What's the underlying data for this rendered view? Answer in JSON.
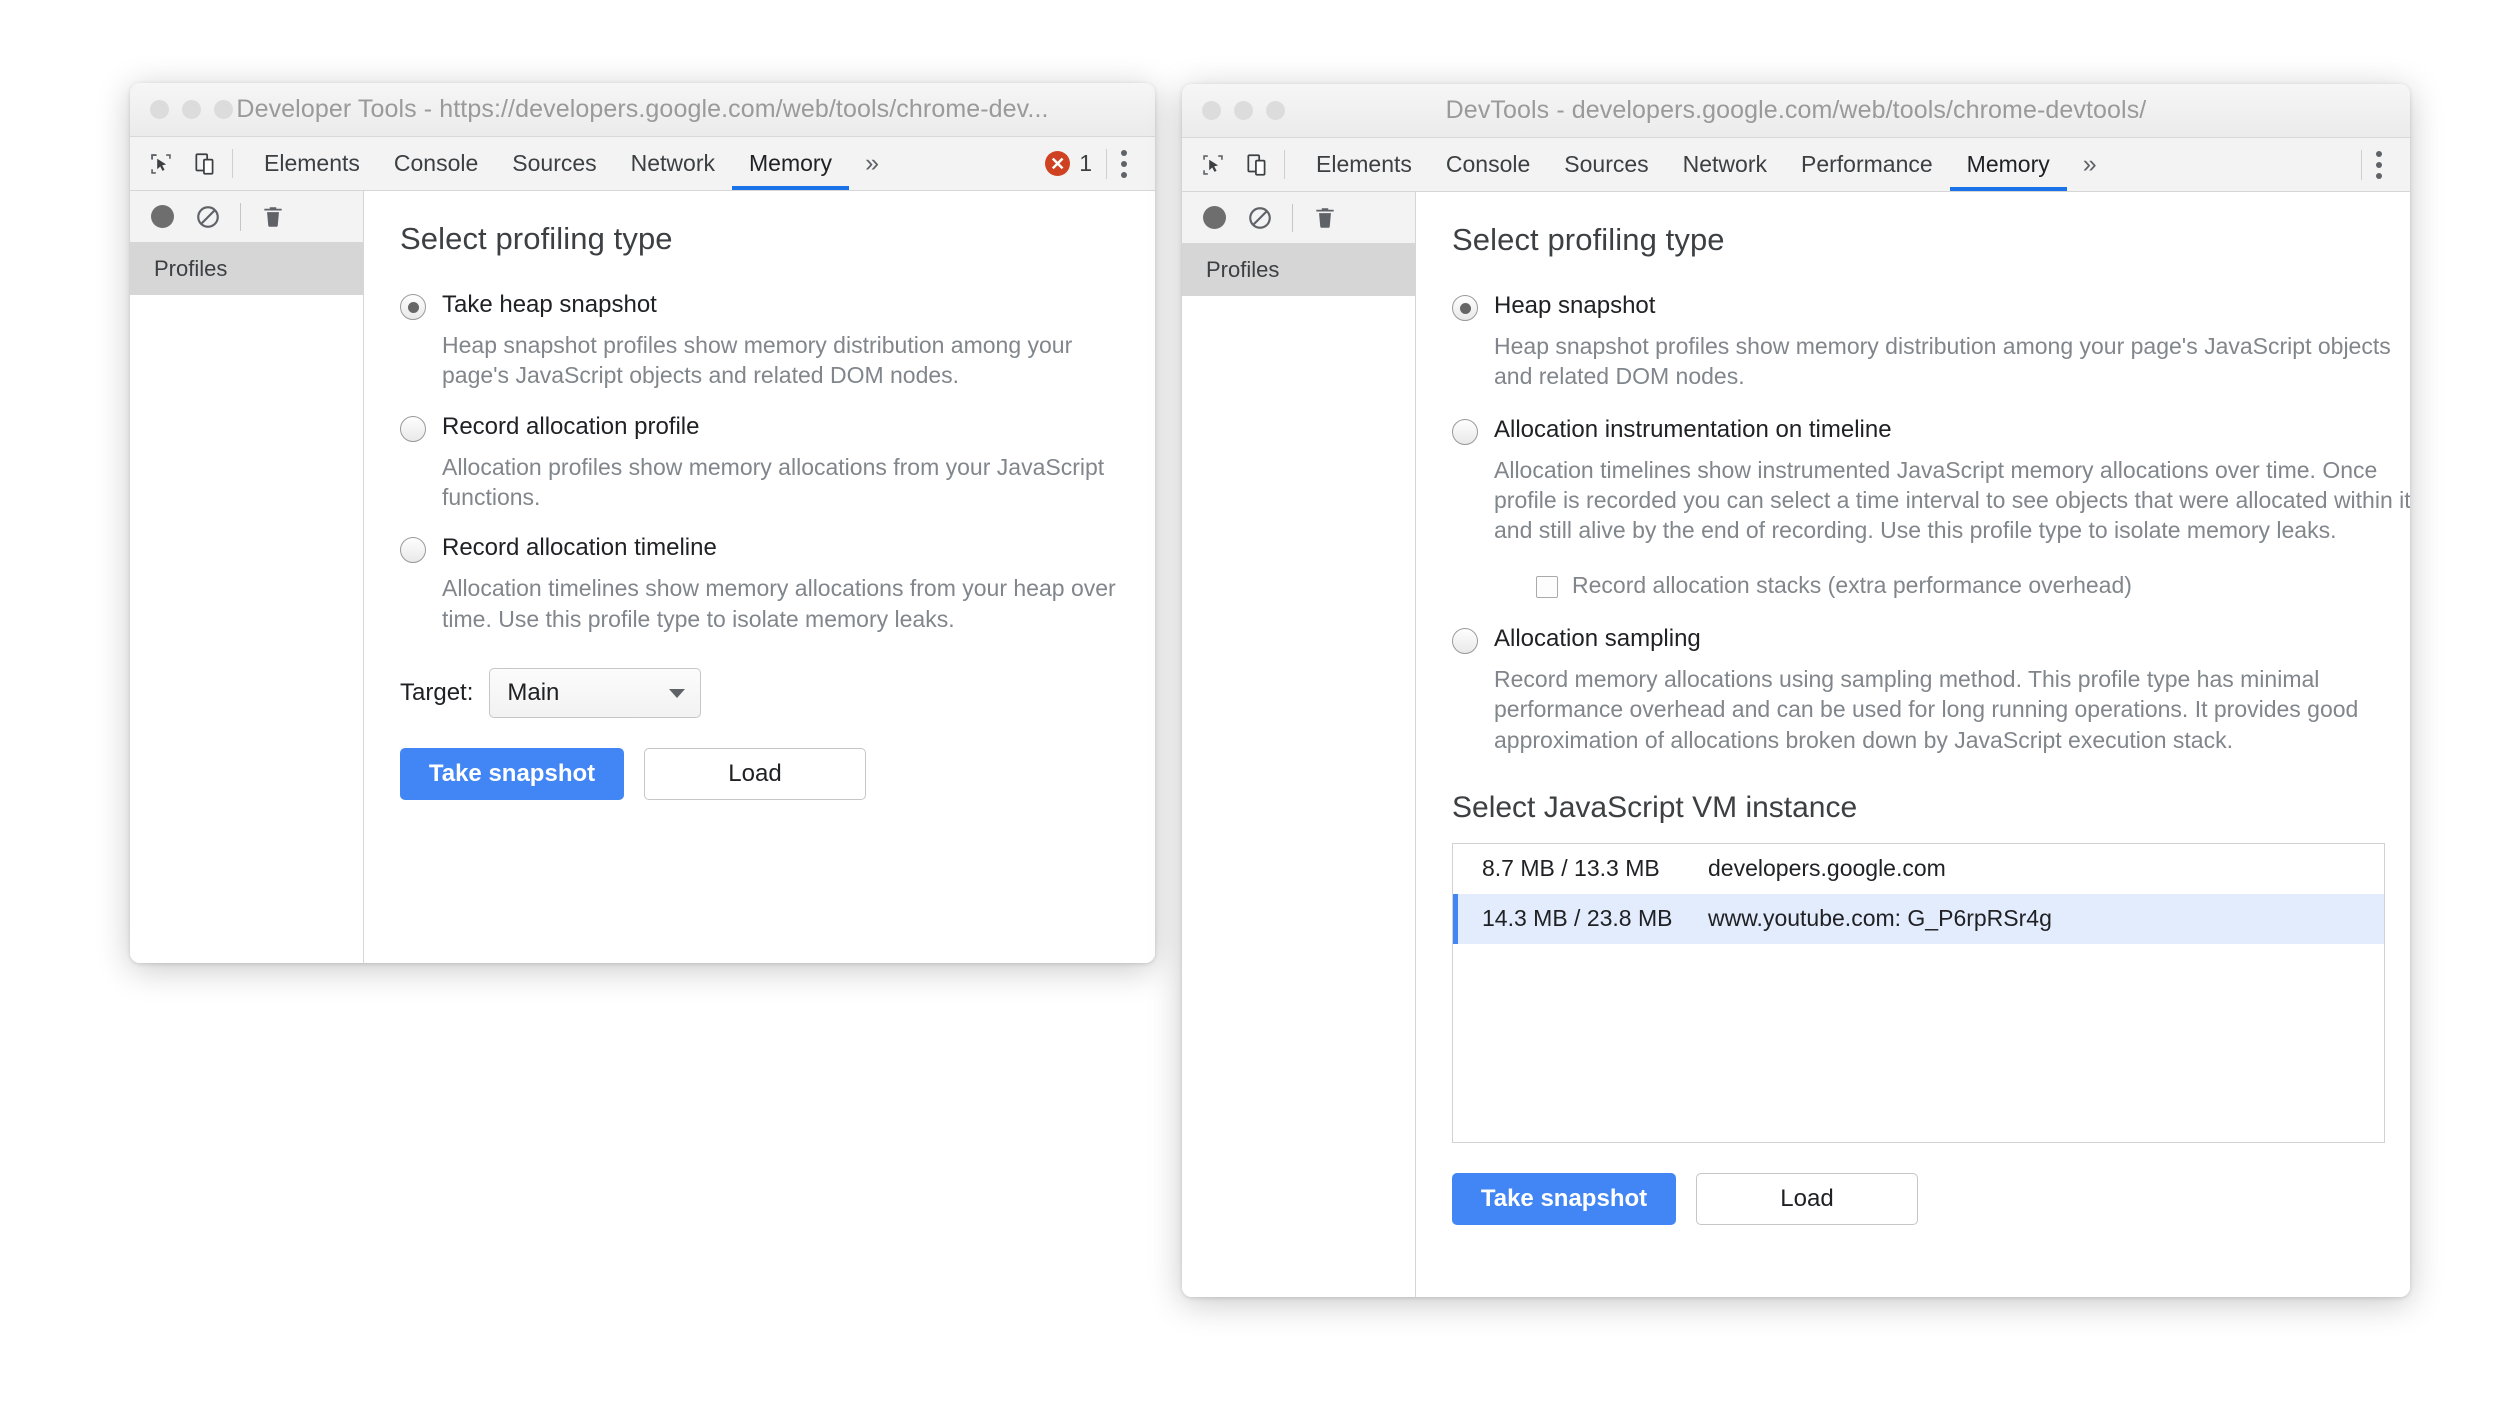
{
  "left_window": {
    "title": "Developer Tools - https://developers.google.com/web/tools/chrome-dev...",
    "toolbar_icons": [
      "inspect-element-icon",
      "device-toolbar-icon"
    ],
    "tabs": [
      {
        "label": "Elements",
        "active": false
      },
      {
        "label": "Console",
        "active": false
      },
      {
        "label": "Sources",
        "active": false
      },
      {
        "label": "Network",
        "active": false
      },
      {
        "label": "Memory",
        "active": true
      }
    ],
    "overflow_label": "»",
    "error_badge": {
      "icon": "✕",
      "count": "1",
      "color": "#cf4221"
    },
    "sidebar": {
      "toolbar_icons": [
        "record-icon",
        "clear-icon",
        "trash-icon"
      ],
      "items": [
        {
          "label": "Profiles",
          "selected": true
        }
      ]
    },
    "panel": {
      "heading": "Select profiling type",
      "options": [
        {
          "label": "Take heap snapshot",
          "checked": true,
          "description": "Heap snapshot profiles show memory distribution among your page's JavaScript objects and related DOM nodes."
        },
        {
          "label": "Record allocation profile",
          "checked": false,
          "description": "Allocation profiles show memory allocations from your JavaScript functions."
        },
        {
          "label": "Record allocation timeline",
          "checked": false,
          "description": "Allocation timelines show memory allocations from your heap over time. Use this profile type to isolate memory leaks."
        }
      ],
      "target": {
        "label": "Target:",
        "value": "Main",
        "options": [
          "Main"
        ]
      },
      "buttons": {
        "primary": "Take snapshot",
        "secondary": "Load"
      }
    }
  },
  "right_window": {
    "title": "DevTools - developers.google.com/web/tools/chrome-devtools/",
    "toolbar_icons": [
      "inspect-element-icon",
      "device-toolbar-icon"
    ],
    "tabs": [
      {
        "label": "Elements",
        "active": false
      },
      {
        "label": "Console",
        "active": false
      },
      {
        "label": "Sources",
        "active": false
      },
      {
        "label": "Network",
        "active": false
      },
      {
        "label": "Performance",
        "active": false
      },
      {
        "label": "Memory",
        "active": true
      }
    ],
    "overflow_label": "»",
    "sidebar": {
      "toolbar_icons": [
        "record-icon",
        "clear-icon",
        "trash-icon"
      ],
      "items": [
        {
          "label": "Profiles",
          "selected": true
        }
      ]
    },
    "panel": {
      "heading": "Select profiling type",
      "options": [
        {
          "label": "Heap snapshot",
          "checked": true,
          "description": "Heap snapshot profiles show memory distribution among your page's JavaScript objects and related DOM nodes."
        },
        {
          "label": "Allocation instrumentation on timeline",
          "checked": false,
          "description": "Allocation timelines show instrumented JavaScript memory allocations over time. Once profile is recorded you can select a time interval to see objects that were allocated within it and still alive by the end of recording. Use this profile type to isolate memory leaks.",
          "checkbox": {
            "label": "Record allocation stacks (extra performance overhead)",
            "checked": false
          }
        },
        {
          "label": "Allocation sampling",
          "checked": false,
          "description": "Record memory allocations using sampling method. This profile type has minimal performance overhead and can be used for long running operations. It provides good approximation of allocations broken down by JavaScript execution stack."
        }
      ],
      "vm_heading": "Select JavaScript VM instance",
      "vm_rows": [
        {
          "size": "8.7 MB / 13.3 MB",
          "name": "developers.google.com",
          "selected": false
        },
        {
          "size": "14.3 MB / 23.8 MB",
          "name": "www.youtube.com: G_P6rpRSr4g",
          "selected": true
        }
      ],
      "buttons": {
        "primary": "Take snapshot",
        "secondary": "Load"
      }
    }
  },
  "accent": {
    "blue": "#4285f4",
    "tab_underline": "#1a73e8",
    "selected_row": "#e3ecfd"
  }
}
